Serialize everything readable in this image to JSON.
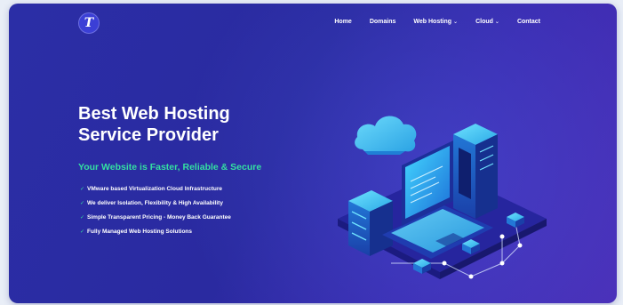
{
  "brand": {
    "logo_letter": "T"
  },
  "nav": {
    "items": [
      {
        "label": "Home",
        "dropdown": false
      },
      {
        "label": "Domains",
        "dropdown": false
      },
      {
        "label": "Web Hosting",
        "dropdown": true
      },
      {
        "label": "Cloud",
        "dropdown": true
      },
      {
        "label": "Contact",
        "dropdown": false
      }
    ]
  },
  "hero": {
    "title_line1": "Best Web Hosting",
    "title_line2": "Service Provider",
    "subtitle": "Your Website is Faster, Reliable & Secure",
    "features": [
      "VMware based Virtualization Cloud Infrastructure",
      "We deliver Isolation, Flexibility & High Availability",
      "Simple Transparent Pricing - Money Back Guarantee",
      "Fully Managed Web Hosting Solutions"
    ]
  },
  "colors": {
    "background": "#2a2aa0",
    "accent": "#34e0a1",
    "illustration": "#2ec8f0"
  },
  "icons": [
    "chevron-down-icon",
    "check-icon",
    "cloud-icon",
    "laptop-icon",
    "server-icon"
  ]
}
